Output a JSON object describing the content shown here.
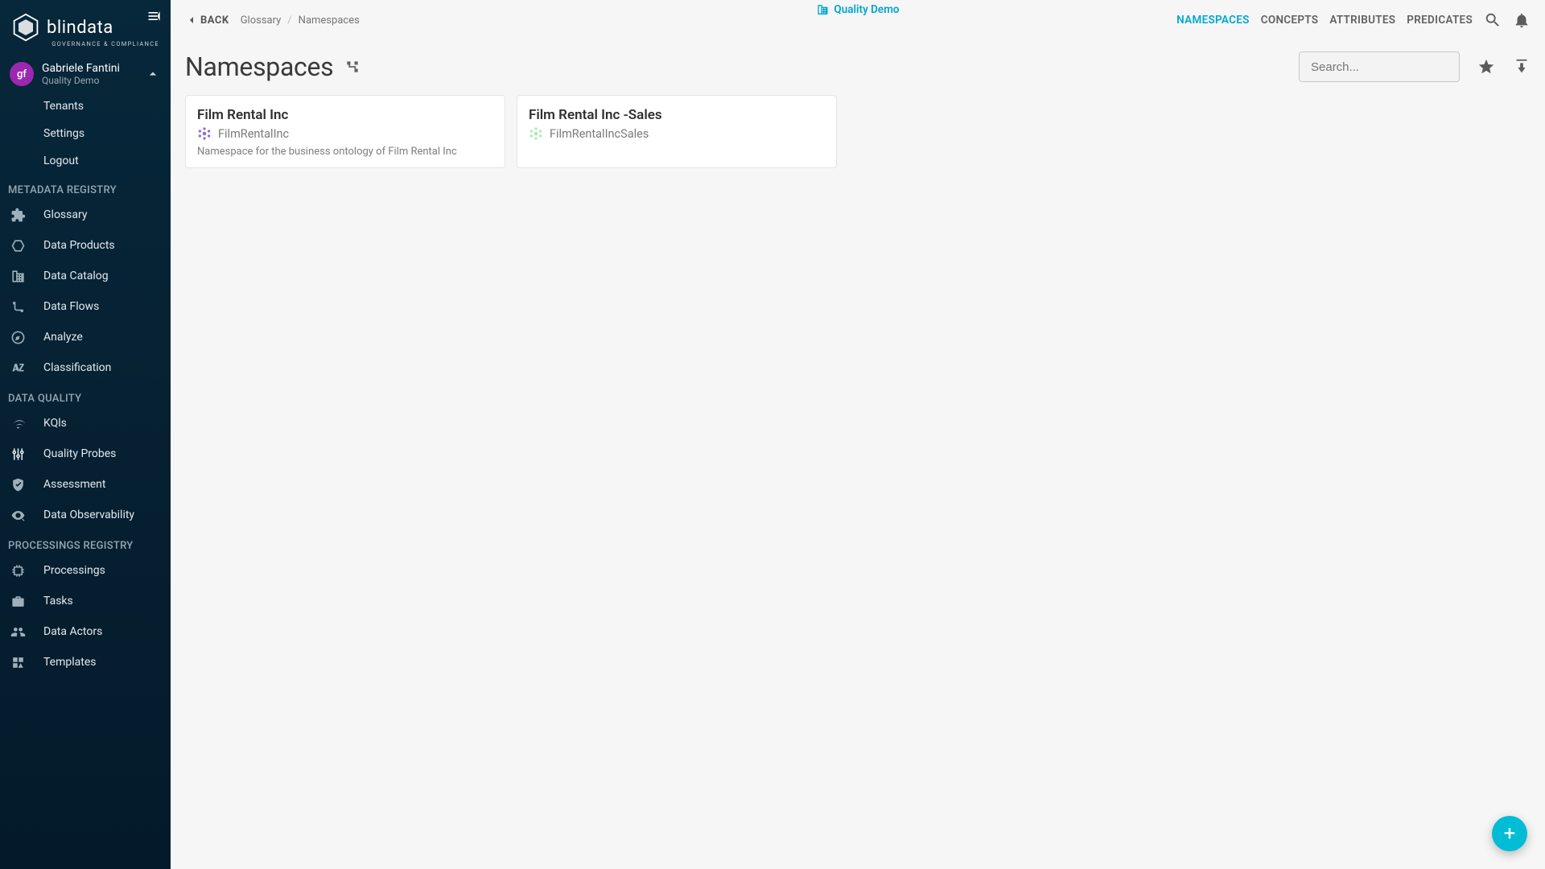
{
  "brand": {
    "name": "blindata",
    "tagline": "GOVERNANCE & COMPLIANCE"
  },
  "user": {
    "initials": "gf",
    "name": "Gabriele Fantini",
    "tenant": "Quality Demo"
  },
  "userMenu": {
    "tenants": "Tenants",
    "settings": "Settings",
    "logout": "Logout"
  },
  "sections": [
    {
      "label": "METADATA REGISTRY",
      "items": [
        {
          "key": "glossary",
          "label": "Glossary",
          "icon": "puzzle"
        },
        {
          "key": "data-products",
          "label": "Data Products",
          "icon": "hexagon"
        },
        {
          "key": "data-catalog",
          "label": "Data Catalog",
          "icon": "domain"
        },
        {
          "key": "data-flows",
          "label": "Data Flows",
          "icon": "flow"
        },
        {
          "key": "analyze",
          "label": "Analyze",
          "icon": "compass"
        },
        {
          "key": "classification",
          "label": "Classification",
          "icon": "az"
        }
      ]
    },
    {
      "label": "DATA QUALITY",
      "items": [
        {
          "key": "kqls",
          "label": "KQls",
          "icon": "wifi"
        },
        {
          "key": "quality-probes",
          "label": "Quality Probes",
          "icon": "tune"
        },
        {
          "key": "assessment",
          "label": "Assessment",
          "icon": "shield"
        },
        {
          "key": "data-observability",
          "label": "Data Observability",
          "icon": "observe"
        }
      ]
    },
    {
      "label": "PROCESSINGS REGISTRY",
      "items": [
        {
          "key": "processings",
          "label": "Processings",
          "icon": "chip"
        },
        {
          "key": "tasks",
          "label": "Tasks",
          "icon": "briefcase"
        },
        {
          "key": "data-actors",
          "label": "Data Actors",
          "icon": "people"
        },
        {
          "key": "templates",
          "label": "Templates",
          "icon": "templates"
        }
      ]
    }
  ],
  "topbar": {
    "back": "BACK",
    "crumbs": [
      "Glossary",
      "Namespaces"
    ],
    "tenantBadge": "Quality Demo",
    "nav": [
      {
        "key": "namespaces",
        "label": "NAMESPACES",
        "active": true
      },
      {
        "key": "concepts",
        "label": "CONCEPTS"
      },
      {
        "key": "attributes",
        "label": "ATTRIBUTES"
      },
      {
        "key": "predicates",
        "label": "PREDICATES"
      }
    ]
  },
  "page": {
    "title": "Namespaces",
    "searchPlaceholder": "Search..."
  },
  "cards": [
    {
      "title": "Film Rental Inc",
      "id": "FilmRentalInc",
      "hashColor": "#8e6bd6",
      "desc": "Namespace for the business ontology of Film Rental Inc"
    },
    {
      "title": "Film Rental Inc -Sales",
      "id": "FilmRentalIncSales",
      "hashColor": "#aee5b8",
      "desc": ""
    }
  ],
  "fab": {
    "label": "+"
  }
}
